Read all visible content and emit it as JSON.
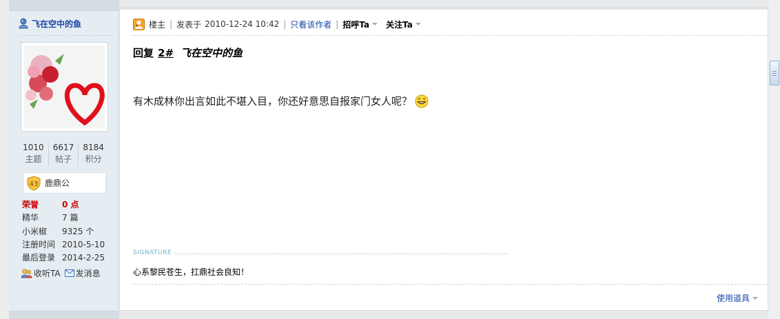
{
  "user": {
    "name": "飞在空中的鱼",
    "stats": [
      {
        "value": "1010",
        "label": "主题"
      },
      {
        "value": "6617",
        "label": "帖子"
      },
      {
        "value": "8184",
        "label": "积分"
      }
    ],
    "level": {
      "num": "43",
      "title": "鹿鼎公"
    },
    "details": [
      {
        "key": "荣誉",
        "value": "0 点"
      },
      {
        "key": "精华",
        "value": "7 篇"
      },
      {
        "key": "小米椒",
        "value": "9325 个"
      },
      {
        "key": "注册时间",
        "value": "2010-5-10"
      },
      {
        "key": "最后登录",
        "value": "2014-2-25"
      }
    ],
    "actions": {
      "follow": "收听TA",
      "message": "发消息"
    }
  },
  "post": {
    "role": "楼主",
    "posted_prefix": "发表于",
    "posted_time": "2010-12-24 10:42",
    "only_author": "只看该作者",
    "greet": "招呼Ta",
    "follow": "关注Ta",
    "reply_prefix": "回复",
    "reply_num": "2#",
    "reply_to": "飞在空中的鱼",
    "content": "有木成林你出言如此不堪入目，你还好意思自报家门女人呢？",
    "signature_label": "SIGNATURE",
    "signature": "心系黎民苍生，扛鼎社会良知！",
    "tools": "使用道具"
  },
  "colors": {
    "link": "#1a46a8",
    "honor": "#cc0000",
    "sidebar_bg": "#e5edf2"
  }
}
